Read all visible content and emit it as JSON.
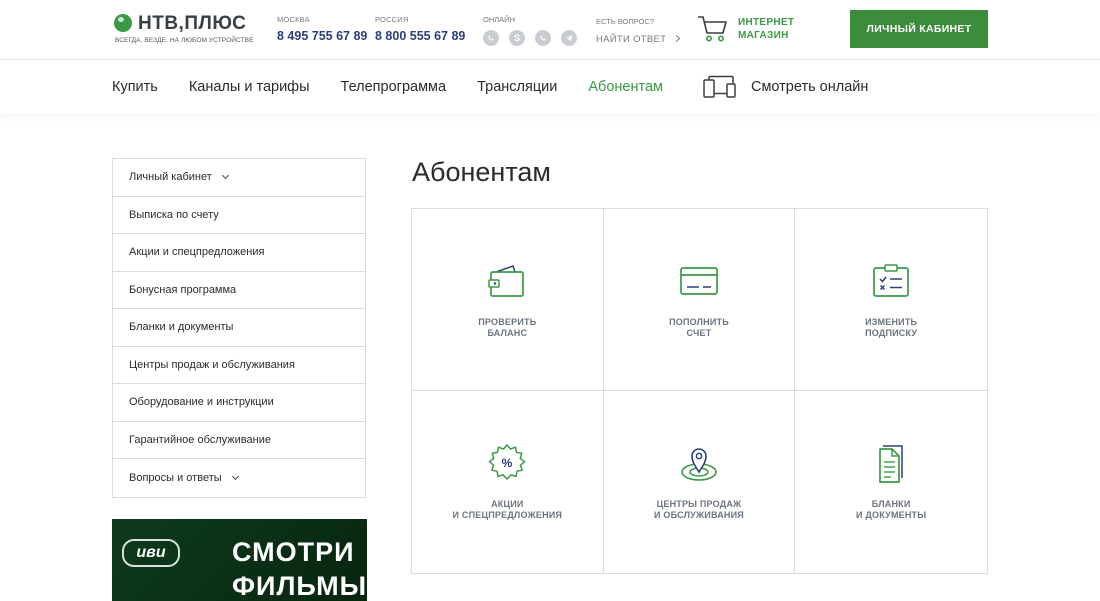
{
  "header": {
    "logo_name": "НТВ,ПЛЮС",
    "logo_tagline": "ВСЕГДА. ВЕЗДЕ. НА ЛЮБОМ УСТРОЙСТВЕ",
    "phone_moscow_label": "МОСКВА",
    "phone_moscow": "8 495 755 67 89",
    "phone_russia_label": "РОССИЯ",
    "phone_russia": "8 800 555 67 89",
    "online_label": "ОНЛАЙН",
    "question_label": "ЕСТЬ ВОПРОС?",
    "question_link": "НАЙТИ ОТВЕТ",
    "shop_label_line1": "ИНТЕРНЕТ",
    "shop_label_line2": "МАГАЗИН",
    "cabinet_button": "ЛИЧНЫЙ КАБИНЕТ"
  },
  "nav": {
    "items": [
      "Купить",
      "Каналы и тарифы",
      "Телепрограмма",
      "Трансляции",
      "Абонентам"
    ],
    "active": "Абонентам",
    "watch_online": "Смотреть онлайн"
  },
  "sidebar": {
    "items": [
      "Личный кабинет",
      "Выписка по счету",
      "Акции и спецпредложения",
      "Бонусная программа",
      "Бланки и документы",
      "Центры продаж и обслуживания",
      "Оборудование и инструкции",
      "Гарантийное обслуживание",
      "Вопросы и ответы"
    ]
  },
  "banner": {
    "brand": "иви",
    "line1": "СМОТРИ",
    "line2": "ФИЛЬМЫ"
  },
  "main": {
    "title": "Абонентам",
    "tiles": [
      {
        "line1": "ПРОВЕРИТЬ",
        "line2": "БАЛАНС",
        "icon": "wallet-icon"
      },
      {
        "line1": "ПОПОЛНИТЬ",
        "line2": "СЧЕТ",
        "icon": "card-icon"
      },
      {
        "line1": "ИЗМЕНИТЬ",
        "line2": "ПОДПИСКУ",
        "icon": "checklist-icon"
      },
      {
        "line1": "АКЦИИ",
        "line2": "И СПЕЦПРЕДЛОЖЕНИЯ",
        "icon": "percent-badge-icon"
      },
      {
        "line1": "ЦЕНТРЫ ПРОДАЖ",
        "line2": "И ОБСЛУЖИВАНИЯ",
        "icon": "location-pin-icon"
      },
      {
        "line1": "БЛАНКИ",
        "line2": "И ДОКУМЕНТЫ",
        "icon": "documents-icon"
      }
    ]
  },
  "colors": {
    "brand_green": "#3b9a45",
    "button_green": "#3b8c3b",
    "phone_blue": "#2c3e7a",
    "icon_navy": "#2c3e7a"
  }
}
